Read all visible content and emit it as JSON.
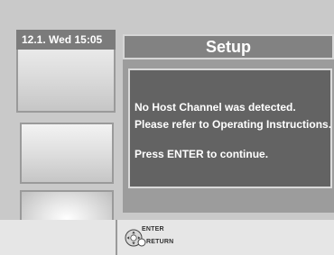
{
  "datetime": "12.1. Wed  15:05",
  "dialog": {
    "title": "Setup",
    "message_lines": [
      "No  Host Channel was detected.",
      "Please refer to Operating Instructions.",
      "Press ENTER to continue."
    ]
  },
  "guide": {
    "enter_label": "ENTER",
    "return_label": "RETURN"
  },
  "icons": {
    "enter": "enter-dpad-icon",
    "return": "return-circle-icon"
  },
  "colors": {
    "title_bar": "#828282",
    "message_box": "#636363",
    "background": "#c9c9c9"
  }
}
